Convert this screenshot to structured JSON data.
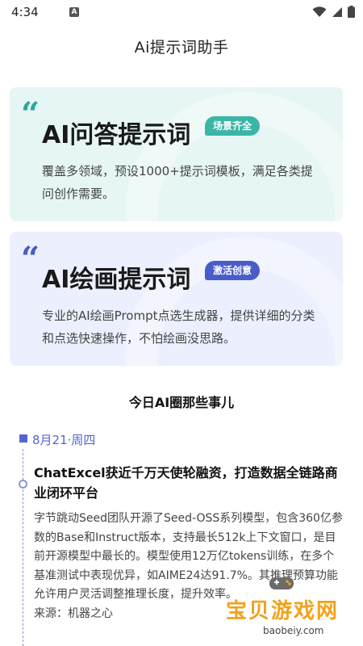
{
  "status_bar": {
    "time": "4:34",
    "icons": [
      "notification-a-icon",
      "wifi-icon",
      "signal-icon",
      "battery-icon"
    ]
  },
  "header": {
    "title": "Ai提示词助手"
  },
  "cards": [
    {
      "title": "AI问答提示词",
      "badge": "场景齐全",
      "description": "覆盖多领域，预设1000+提示词模板，满足各类提问创作需要。",
      "accent": "#3bb5a6",
      "background": "#e6f6f4"
    },
    {
      "title": "AI绘画提示词",
      "badge": "激活创意",
      "description": "专业的AI绘画Prompt点选生成器，提供详细的分类和点选快速操作，不怕绘画没思路。",
      "accent": "#4a5cc8",
      "background": "#eceffd"
    }
  ],
  "news_section": {
    "title": "今日AI圈那些事儿",
    "date": "8月21·周四",
    "items": [
      {
        "headline": "ChatExcel获近千万天使轮融资，打造数据全链路商业闭环平台",
        "body": "字节跳动Seed团队开源了Seed-OSS系列模型，包含360亿参数的Base和Instruct版本，支持最长512k上下文窗口，是目前开源模型中最长的。模型使用12万亿tokens训练，在多个基准测试中表现优异，如AIME24达91.7%。其推理预算功能允许用户灵活调整推理长度，提升效率。",
        "source": "来源：机器之心"
      }
    ]
  },
  "watermark": {
    "title": "宝贝游戏网",
    "url": "baobeiy.com"
  }
}
